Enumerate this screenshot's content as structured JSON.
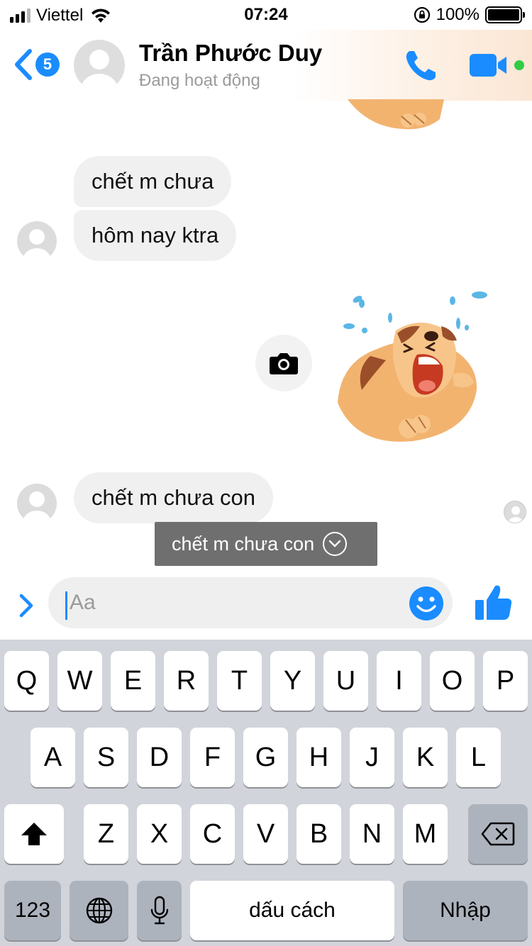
{
  "status_bar": {
    "carrier": "Viettel",
    "time": "07:24",
    "battery": "100%"
  },
  "header": {
    "back_badge": "5",
    "contact_name": "Trần Phước Duy",
    "contact_status": "Đang hoạt động"
  },
  "messages": [
    {
      "sender": "contact",
      "text": "chết m chưa"
    },
    {
      "sender": "contact",
      "text": "hôm nay ktra"
    },
    {
      "sender": "contact",
      "text": "chết m chưa con"
    }
  ],
  "translation_tooltip": {
    "text": "chết m chưa con"
  },
  "composer": {
    "placeholder": "Aa"
  },
  "keyboard": {
    "row1": [
      "Q",
      "W",
      "E",
      "R",
      "T",
      "Y",
      "U",
      "I",
      "O",
      "P"
    ],
    "row2": [
      "A",
      "S",
      "D",
      "F",
      "G",
      "H",
      "J",
      "K",
      "L"
    ],
    "row3": [
      "Z",
      "X",
      "C",
      "V",
      "B",
      "N",
      "M"
    ],
    "numbers_key": "123",
    "space_key": "dấu cách",
    "return_key": "Nhập"
  },
  "colors": {
    "accent": "#1a8cff",
    "bubble": "#f0f0f0",
    "keyboard_bg": "#d1d4da",
    "active_dot": "#31cc46"
  },
  "icons": [
    "back-chevron-icon",
    "phone-icon",
    "video-camera-icon",
    "camera-icon",
    "emoji-icon",
    "thumbs-up-icon",
    "shift-icon",
    "backspace-icon",
    "globe-icon",
    "microphone-icon"
  ]
}
